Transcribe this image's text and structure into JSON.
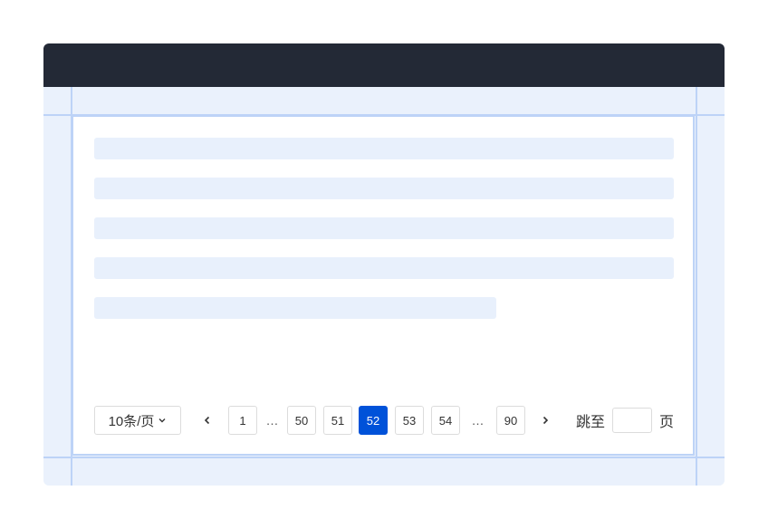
{
  "pagination": {
    "page_size_label": "10条/页",
    "prev_icon": "chevron-left-icon",
    "next_icon": "chevron-right-icon",
    "pages": [
      {
        "label": "1",
        "active": false
      },
      {
        "label": "…",
        "ellipsis": true
      },
      {
        "label": "50",
        "active": false
      },
      {
        "label": "51",
        "active": false
      },
      {
        "label": "52",
        "active": true
      },
      {
        "label": "53",
        "active": false
      },
      {
        "label": "54",
        "active": false
      },
      {
        "label": "…",
        "ellipsis": true
      },
      {
        "label": "90",
        "active": false
      }
    ],
    "current_page": 52,
    "jump_label": "跳至",
    "jump_value": "",
    "page_unit": "页"
  },
  "colors": {
    "topbar": "#232936",
    "active_page": "#0052d9",
    "guide_line": "#bdd3f7",
    "skeleton": "#e8f0fc"
  }
}
